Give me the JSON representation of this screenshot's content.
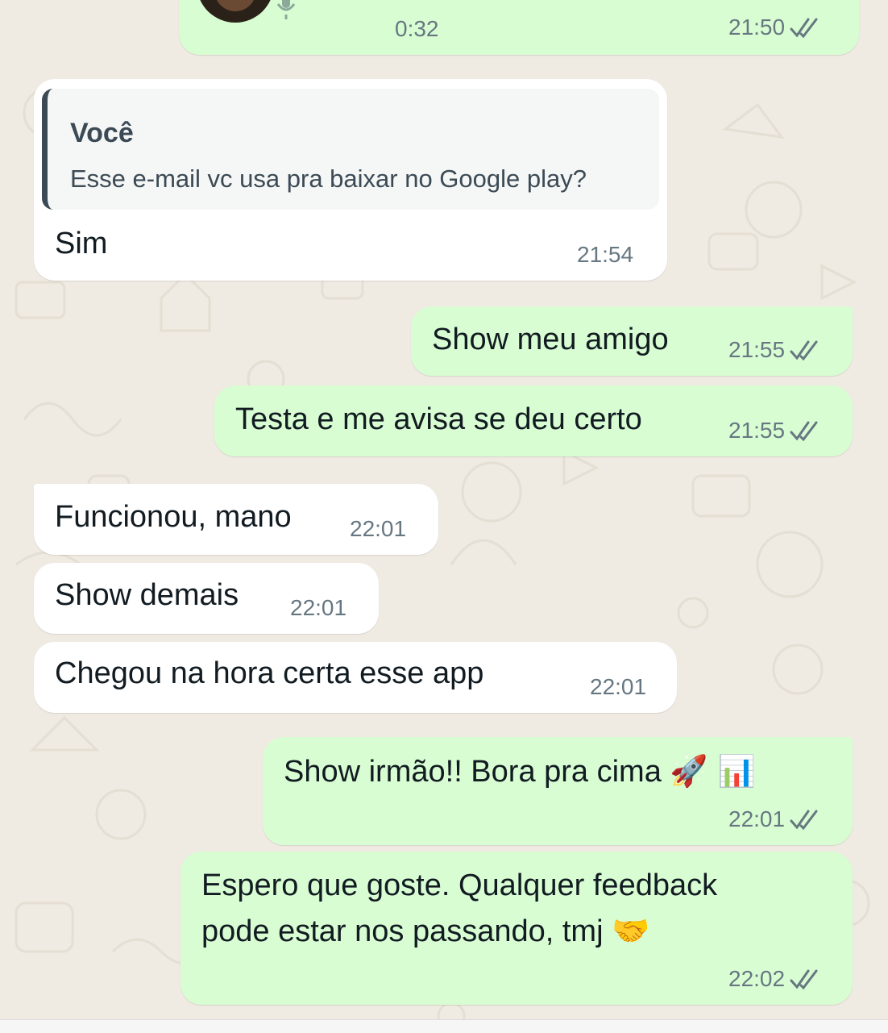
{
  "colors": {
    "wallpaper": "#efeae2",
    "incoming_bubble": "#ffffff",
    "outgoing_bubble": "#d9fdd3",
    "read_ticks": "#667781"
  },
  "voice_note": {
    "duration": "0:32",
    "time": "21:50",
    "status": "double-check-icon",
    "avatar": "avatar",
    "icon": "microphone-icon"
  },
  "messages": [
    {
      "reply": {
        "author": "Você",
        "text": "Esse e-mail vc usa pra baixar no Google play?"
      },
      "text": "Sim",
      "time": "21:54"
    },
    {
      "text": "Show meu amigo",
      "time": "21:55",
      "status": "double-check-icon"
    },
    {
      "text": "Testa e me avisa se deu certo",
      "time": "21:55",
      "status": "double-check-icon"
    },
    {
      "text": "Funcionou, mano",
      "time": "22:01"
    },
    {
      "text": "Show demais",
      "time": "22:01"
    },
    {
      "text": "Chegou na hora certa esse app",
      "time": "22:01"
    },
    {
      "text": "Show irmão!! Bora pra cima",
      "emoji": "🚀 📊",
      "time": "22:01",
      "status": "double-check-icon"
    },
    {
      "line1": "Espero que goste. Qualquer feedback",
      "line2": "pode estar nos passando, tmj",
      "emoji": "🤝",
      "time": "22:02",
      "status": "double-check-icon"
    }
  ]
}
